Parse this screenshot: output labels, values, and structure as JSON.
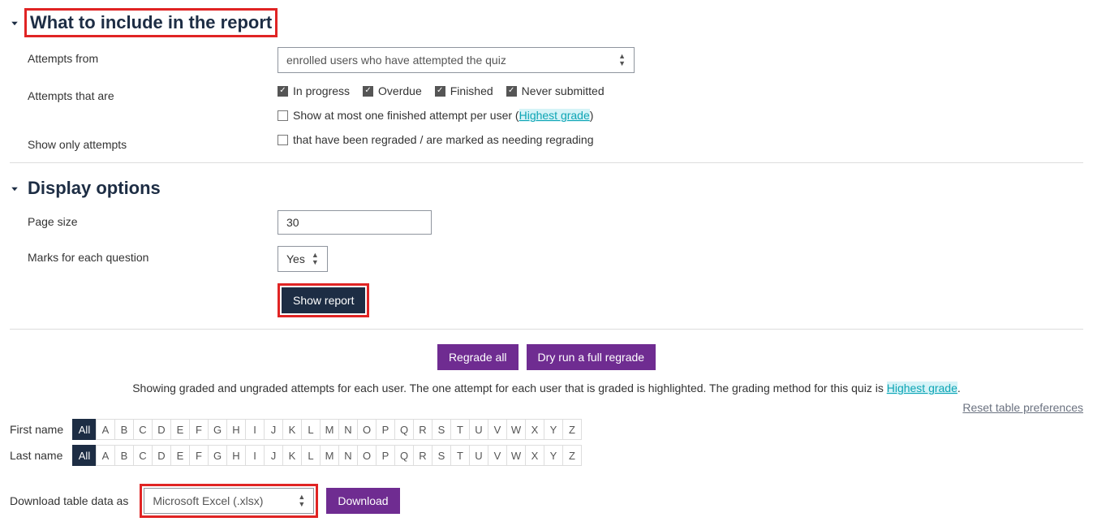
{
  "section1": {
    "title": "What to include in the report",
    "attempts_from_label": "Attempts from",
    "attempts_from_value": "enrolled users who have attempted the quiz",
    "attempts_that_are_label": "Attempts that are",
    "cb_inprogress": "In progress",
    "cb_overdue": "Overdue",
    "cb_finished": "Finished",
    "cb_never": "Never submitted",
    "cb_atmost_prefix": "Show at most one finished attempt per user (",
    "cb_atmost_link": "Highest grade",
    "cb_atmost_suffix": ")",
    "show_only_label": "Show only attempts",
    "cb_regraded": "that have been regraded / are marked as needing regrading"
  },
  "section2": {
    "title": "Display options",
    "page_size_label": "Page size",
    "page_size_value": "30",
    "marks_label": "Marks for each question",
    "marks_value": "Yes",
    "show_report_btn": "Show report"
  },
  "regrade": {
    "regrade_all": "Regrade all",
    "dry_run": "Dry run a full regrade"
  },
  "info": {
    "text_prefix": "Showing graded and ungraded attempts for each user. The one attempt for each user that is graded is highlighted. The grading method for this quiz is ",
    "text_link": "Highest grade",
    "text_suffix": "."
  },
  "reset_link": "Reset table preferences",
  "alpha": {
    "firstname_label": "First name",
    "lastname_label": "Last name",
    "all": "All",
    "letters": [
      "A",
      "B",
      "C",
      "D",
      "E",
      "F",
      "G",
      "H",
      "I",
      "J",
      "K",
      "L",
      "M",
      "N",
      "O",
      "P",
      "Q",
      "R",
      "S",
      "T",
      "U",
      "V",
      "W",
      "X",
      "Y",
      "Z"
    ]
  },
  "download": {
    "label": "Download table data as",
    "format": "Microsoft Excel (.xlsx)",
    "btn": "Download"
  }
}
